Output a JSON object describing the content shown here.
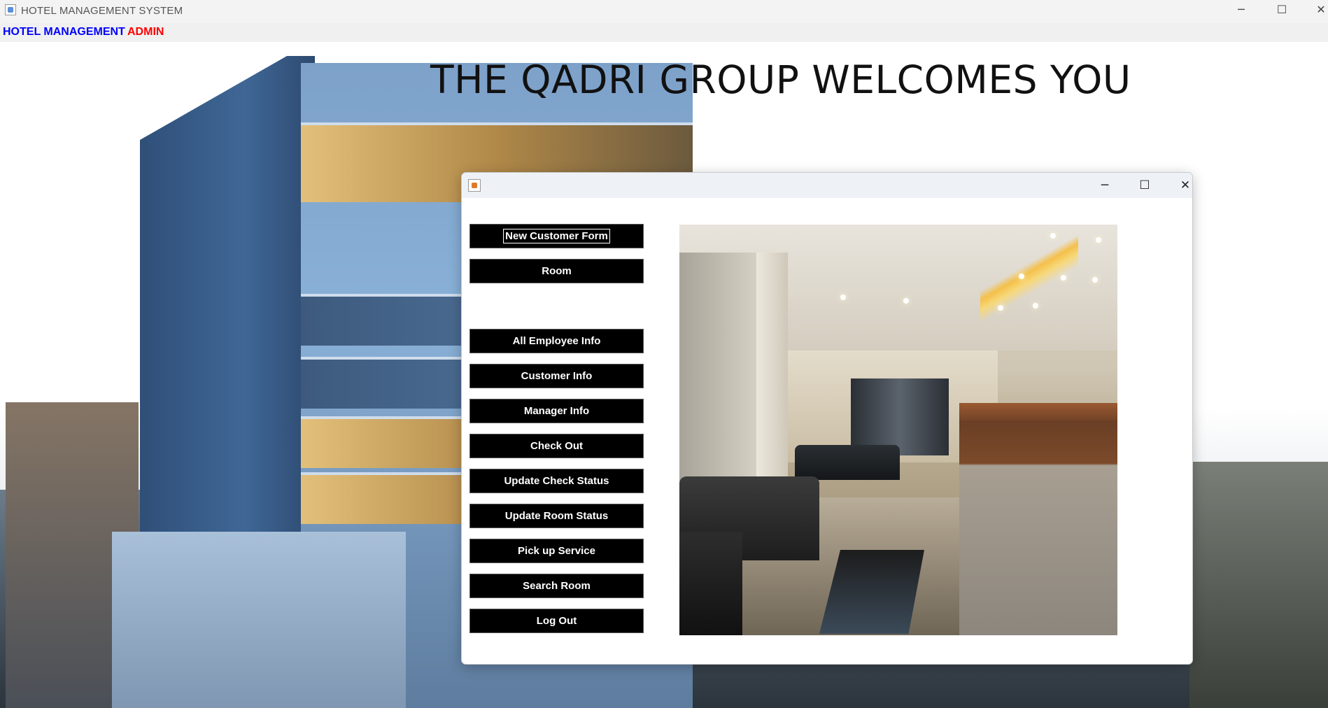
{
  "window": {
    "title": "HOTEL MANAGEMENT SYSTEM",
    "controls": {
      "minimize": "─",
      "maximize": "☐",
      "close": "✕"
    }
  },
  "menubar": {
    "items": [
      {
        "label": "HOTEL MANAGEMENT",
        "color": "#0000ff"
      },
      {
        "label": "ADMIN",
        "color": "#ff0000"
      }
    ]
  },
  "banner": {
    "text": "THE QADRI GROUP WELCOMES YOU"
  },
  "dialog": {
    "title": "",
    "controls": {
      "minimize": "─",
      "maximize": "☐",
      "close": "✕"
    },
    "buttons": [
      {
        "label": "New Customer Form",
        "focused": true
      },
      {
        "label": "Room"
      },
      {
        "label": "All Employee Info"
      },
      {
        "label": "Customer Info"
      },
      {
        "label": "Manager Info"
      },
      {
        "label": "Check Out"
      },
      {
        "label": "Update Check Status"
      },
      {
        "label": "Update Room Status"
      },
      {
        "label": "Pick up Service"
      },
      {
        "label": "Search Room"
      },
      {
        "label": "Log Out"
      }
    ]
  },
  "colors": {
    "menu_blue": "#0000ff",
    "menu_red": "#ff0000",
    "button_bg": "#000000",
    "button_text": "#ffffff"
  }
}
